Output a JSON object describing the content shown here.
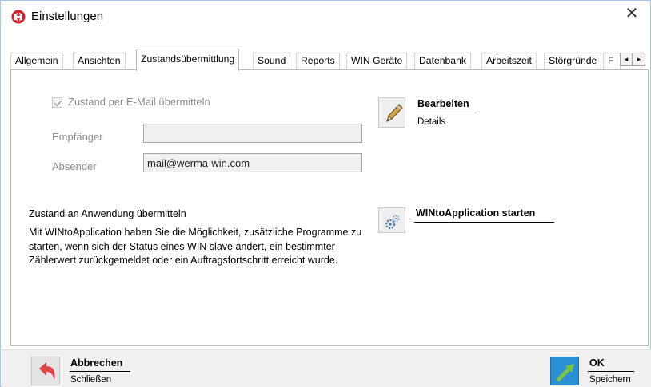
{
  "window": {
    "title": "Einstellungen",
    "close_label": "✕"
  },
  "tabs": [
    {
      "label": "Allgemein",
      "active": false
    },
    {
      "label": "Ansichten",
      "active": false
    },
    {
      "label": "Zustandsübermittlung",
      "active": true
    },
    {
      "label": "Sound",
      "active": false
    },
    {
      "label": "Reports",
      "active": false
    },
    {
      "label": "WIN Geräte",
      "active": false
    },
    {
      "label": "Datenbank",
      "active": false
    },
    {
      "label": "Arbeitszeit",
      "active": false
    },
    {
      "label": "Störgründe",
      "active": false
    },
    {
      "label": "F",
      "active": false
    }
  ],
  "tab_scroll": {
    "left": "◂",
    "right": "▸"
  },
  "email": {
    "checkbox_label": "Zustand per E-Mail übermitteln",
    "checked": true,
    "recipient_label": "Empfänger",
    "recipient_value": "",
    "sender_label": "Absender",
    "sender_value": "mail@werma-win.com"
  },
  "edit_action": {
    "title": "Bearbeiten",
    "subtitle": "Details",
    "icon": "pencil-icon"
  },
  "application": {
    "section_title": "Zustand an Anwendung übermitteln",
    "description": "Mit WINtoApplication haben Sie die Möglichkeit, zusätzliche Programme zu starten, wenn sich der Status eines WIN slave ändert, ein bestimmter Zählerwert zurückgemeldet oder ein Auftragsfortschritt erreicht wurde.",
    "start_title": "WINtoApplication starten",
    "icon": "gears-icon"
  },
  "footer": {
    "cancel_title": "Abbrechen",
    "cancel_subtitle": "Schließen",
    "ok_title": "OK",
    "ok_subtitle": "Speichern"
  },
  "colors": {
    "cancel_arrow": "#e0424a",
    "ok_arrow": "#7cc242",
    "ok_icon_bg": "#2a8fd4",
    "app_icon": "#d2202d"
  }
}
